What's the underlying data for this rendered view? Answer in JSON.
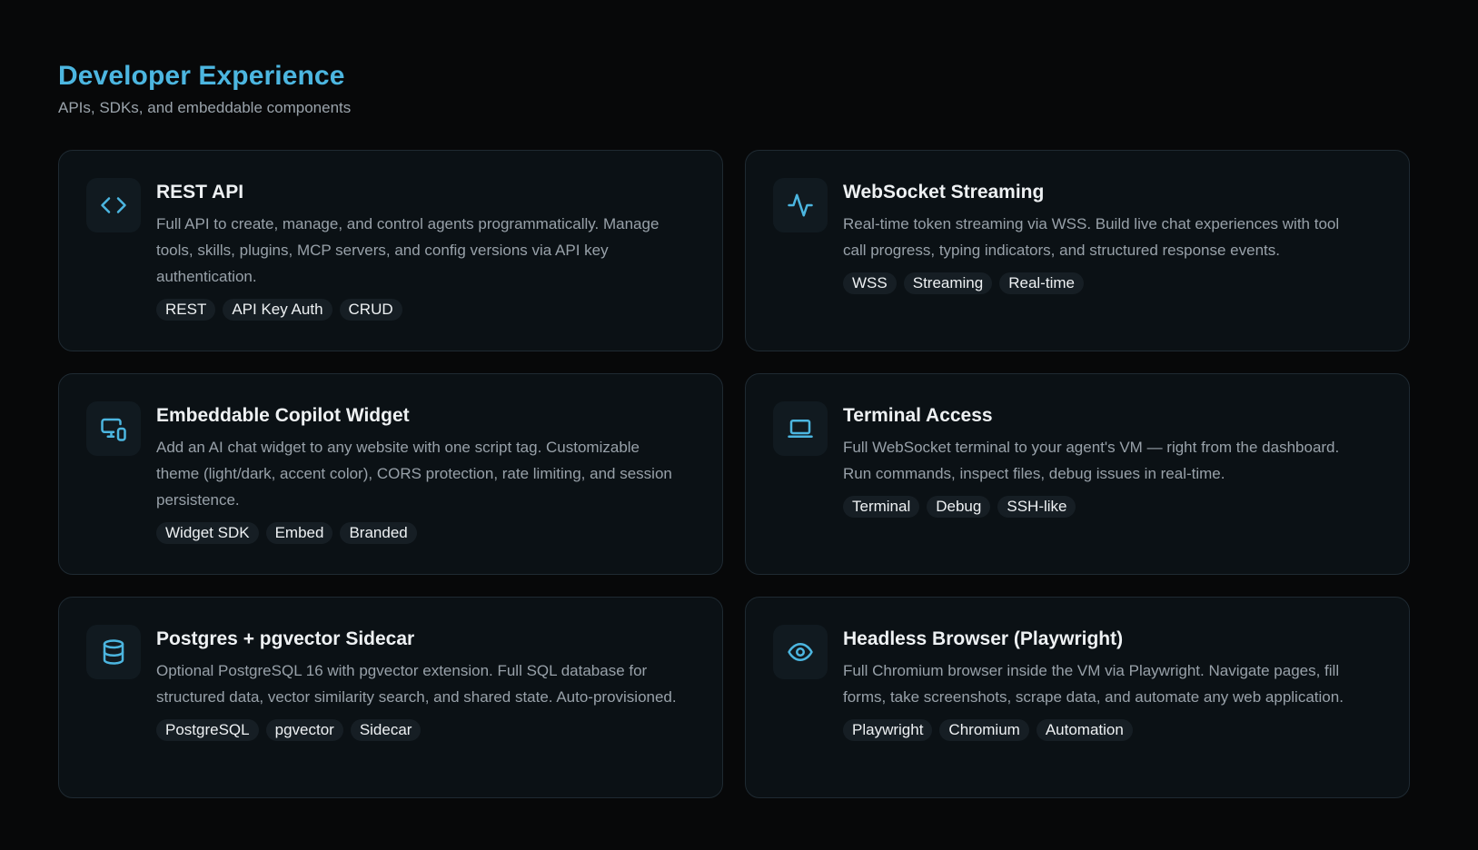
{
  "header": {
    "title": "Developer Experience",
    "subtitle": "APIs, SDKs, and embeddable components"
  },
  "theme": {
    "accent": "#4cb6e0",
    "background": "#070809",
    "card_background": "#0b1115",
    "card_border": "#1f2a32"
  },
  "cards": [
    {
      "icon": "code-icon",
      "title": "REST API",
      "description": "Full API to create, manage, and control agents programmatically. Manage tools, skills, plugins, MCP servers, and config versions via API key authentication.",
      "tags": [
        "REST",
        "API Key Auth",
        "CRUD"
      ]
    },
    {
      "icon": "activity-icon",
      "title": "WebSocket Streaming",
      "description": "Real-time token streaming via WSS. Build live chat experiences with tool call progress, typing indicators, and structured response events.",
      "tags": [
        "WSS",
        "Streaming",
        "Real-time"
      ]
    },
    {
      "icon": "devices-icon",
      "title": "Embeddable Copilot Widget",
      "description": "Add an AI chat widget to any website with one script tag. Customizable theme (light/dark, accent color), CORS protection, rate limiting, and session persistence.",
      "tags": [
        "Widget SDK",
        "Embed",
        "Branded"
      ]
    },
    {
      "icon": "laptop-icon",
      "title": "Terminal Access",
      "description": "Full WebSocket terminal to your agent's VM — right from the dashboard. Run commands, inspect files, debug issues in real-time.",
      "tags": [
        "Terminal",
        "Debug",
        "SSH-like"
      ]
    },
    {
      "icon": "database-icon",
      "title": "Postgres + pgvector Sidecar",
      "description": "Optional PostgreSQL 16 with pgvector extension. Full SQL database for structured data, vector similarity search, and shared state. Auto-provisioned.",
      "tags": [
        "PostgreSQL",
        "pgvector",
        "Sidecar"
      ]
    },
    {
      "icon": "eye-icon",
      "title": "Headless Browser (Playwright)",
      "description": "Full Chromium browser inside the VM via Playwright. Navigate pages, fill forms, take screenshots, scrape data, and automate any web application.",
      "tags": [
        "Playwright",
        "Chromium",
        "Automation"
      ]
    }
  ]
}
